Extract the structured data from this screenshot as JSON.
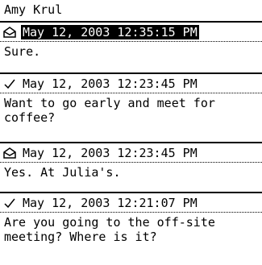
{
  "contact_name": "Amy Krul",
  "messages": [
    {
      "icon": "envelope-open-icon",
      "timestamp": "May 12, 2003 12:35:15 PM",
      "body": "Sure.",
      "selected": true
    },
    {
      "icon": "checkmark-icon",
      "timestamp": "May 12, 2003 12:23:45 PM",
      "body": "Want to go early and meet for coffee?",
      "selected": false
    },
    {
      "icon": "envelope-open-icon",
      "timestamp": "May 12, 2003 12:23:45 PM",
      "body": "Yes. At Julia's.",
      "selected": false
    },
    {
      "icon": "checkmark-icon",
      "timestamp": "May 12, 2003 12:21:07 PM",
      "body": "Are you going to the off-site meeting? Where is it?",
      "selected": false
    }
  ]
}
